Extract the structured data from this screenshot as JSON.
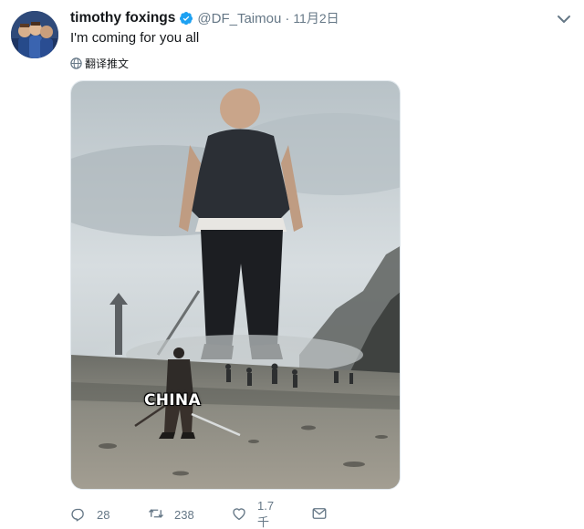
{
  "user": {
    "name": "timothy foxings",
    "handle": "@DF_Taimou",
    "date": "11月2日",
    "verified": true
  },
  "tweet": {
    "text": "I'm coming for you all",
    "translate_label": "翻译推文"
  },
  "media": {
    "overlay_text": "CHINA"
  },
  "actions": {
    "reply_count": "28",
    "retweet_count": "238",
    "like_count": "1.7千"
  },
  "colors": {
    "text_primary": "#14171a",
    "text_secondary": "#657786",
    "verified_blue": "#1da1f2",
    "border": "#e1e8ed"
  },
  "icons": [
    "verified-badge-icon",
    "chevron-down-icon",
    "globe-icon",
    "reply-icon",
    "retweet-icon",
    "like-icon",
    "direct-message-icon"
  ]
}
